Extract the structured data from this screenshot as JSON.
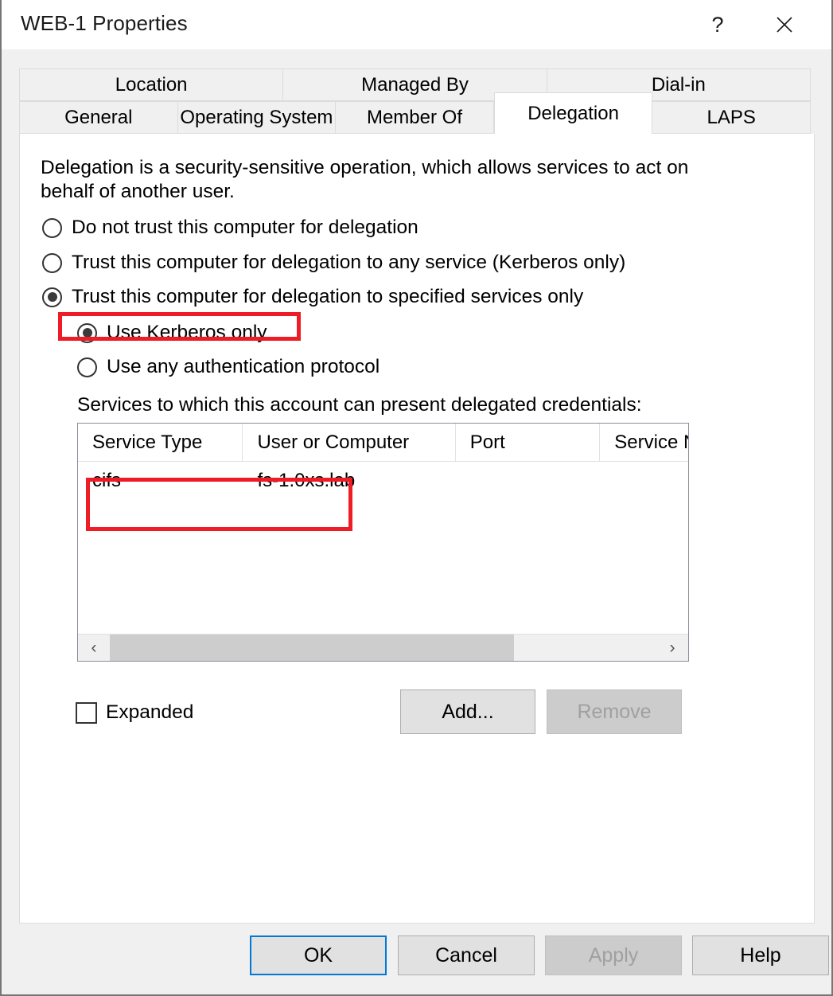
{
  "window": {
    "title": "WEB-1 Properties",
    "help_icon": "question-mark-icon",
    "close_icon": "close-icon",
    "help_glyph": "?",
    "close_glyph": "✕"
  },
  "tabs": {
    "top_row": [
      {
        "label": "Location",
        "selected": false
      },
      {
        "label": "Managed By",
        "selected": false
      },
      {
        "label": "Dial-in",
        "selected": false
      }
    ],
    "bottom_row": [
      {
        "label": "General",
        "selected": false
      },
      {
        "label": "Operating System",
        "selected": false
      },
      {
        "label": "Member Of",
        "selected": false
      },
      {
        "label": "Delegation",
        "selected": true
      },
      {
        "label": "LAPS",
        "selected": false
      }
    ]
  },
  "delegation": {
    "intro": "Delegation is a security-sensitive operation, which allows services to act on behalf of another user.",
    "options": [
      {
        "label": "Do not trust this computer for delegation",
        "checked": false
      },
      {
        "label": "Trust this computer for delegation to any service (Kerberos only)",
        "checked": false
      },
      {
        "label": "Trust this computer for delegation to specified services only",
        "checked": true
      }
    ],
    "sub_options": [
      {
        "label": "Use Kerberos only",
        "checked": true
      },
      {
        "label": "Use any authentication protocol",
        "checked": false
      }
    ],
    "list_label": "Services to which this account can present delegated credentials:",
    "columns": [
      "Service Type",
      "User or Computer",
      "Port",
      "Service Na"
    ],
    "rows": [
      {
        "service_type": "cifs",
        "user_or_computer": "fs-1.0xs.lab",
        "port": "",
        "service_name": ""
      }
    ],
    "expanded_label": "Expanded",
    "expanded_checked": false,
    "add_label": "Add...",
    "remove_label": "Remove",
    "remove_disabled": true,
    "scroll_left_glyph": "‹",
    "scroll_right_glyph": "›"
  },
  "footer": {
    "ok_label": "OK",
    "cancel_label": "Cancel",
    "apply_label": "Apply",
    "help_label": "Help",
    "apply_disabled": true,
    "ok_focused": true
  },
  "colors": {
    "annotation_red": "#ee1c25",
    "focus_blue": "#0078d7",
    "dialog_gray": "#f0f0f0",
    "panel_white": "#ffffff"
  }
}
